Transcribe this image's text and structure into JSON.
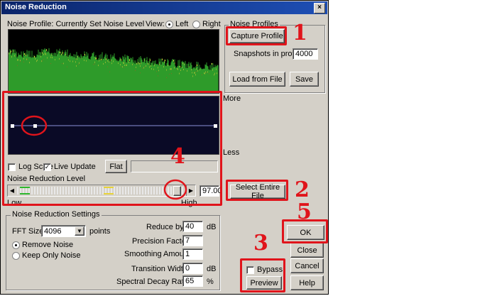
{
  "window": {
    "title": "Noise Reduction",
    "close_glyph": "×"
  },
  "profile": {
    "label": "Noise Profile: Currently Set Noise Level",
    "view_label": "View:",
    "view_left": "Left",
    "view_right": "Right"
  },
  "noise_profiles": {
    "group_label": "Noise Profiles",
    "capture_button": "Capture Profile",
    "snapshots_label": "Snapshots in profile",
    "snapshots_value": "4000",
    "load_button": "Load from File",
    "save_button": "Save"
  },
  "curve": {
    "more_label": "More",
    "less_label": "Less"
  },
  "options": {
    "log_scale_label": "Log Scale",
    "log_scale_checked": false,
    "live_update_label": "Live Update",
    "live_update_checked": true,
    "flat_button": "Flat"
  },
  "reduction_level": {
    "label": "Noise Reduction Level",
    "value": "97.00",
    "low_label": "Low",
    "high_label": "High",
    "level_fraction": 0.97
  },
  "select_entire_file_button": "Select Entire File",
  "settings": {
    "group_label": "Noise Reduction Settings",
    "fft_label": "FFT Size",
    "fft_value": "4096",
    "fft_units": "points",
    "remove_noise_label": "Remove Noise",
    "keep_only_noise_label": "Keep Only Noise",
    "reduce_by_label": "Reduce by",
    "reduce_by_value": "40",
    "reduce_by_unit": "dB",
    "precision_label": "Precision Factor",
    "precision_value": "7",
    "smoothing_label": "Smoothing Amount",
    "smoothing_value": "1",
    "transition_label": "Transition Width",
    "transition_value": "0",
    "transition_unit": "dB",
    "decay_label": "Spectral Decay Rate",
    "decay_value": "65",
    "decay_unit": "%"
  },
  "actions": {
    "bypass_label": "Bypass",
    "preview_button": "Preview",
    "ok_button": "OK",
    "close_button": "Close",
    "cancel_button": "Cancel",
    "help_button": "Help"
  },
  "annotations": [
    "1",
    "2",
    "3",
    "4",
    "5"
  ],
  "colors": {
    "annotation_red": "#e0141b",
    "title_blue": "#0a246a",
    "spectrum_green": "#2e9b2a",
    "spectrum_yellow": "#e8d33a"
  }
}
